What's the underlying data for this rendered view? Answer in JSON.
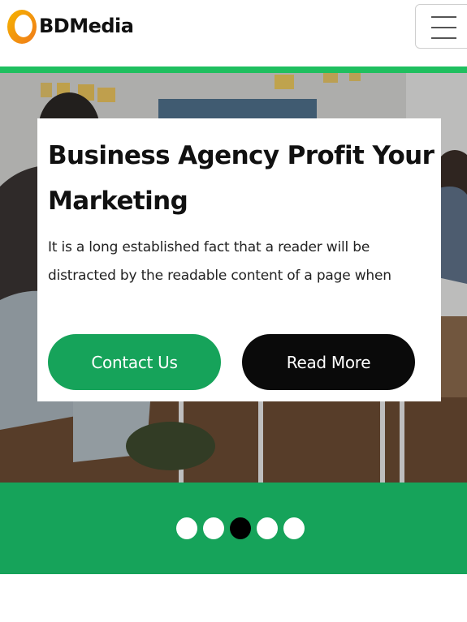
{
  "header": {
    "brand": "BDMedia",
    "logo_icon": "circle-logo-icon",
    "menu_icon": "hamburger-menu-icon"
  },
  "colors": {
    "accent": "#1fbf5f",
    "green": "#16a35a",
    "dark": "#0a0a0a"
  },
  "hero": {
    "title": "Business Agency Profit Your Marketing",
    "description": "It is a long established fact that a reader will be distracted by the readable content of a page when",
    "buttons": {
      "contact": "Contact Us",
      "read_more": "Read More"
    }
  },
  "slider": {
    "total": 5,
    "active_index": 2
  }
}
